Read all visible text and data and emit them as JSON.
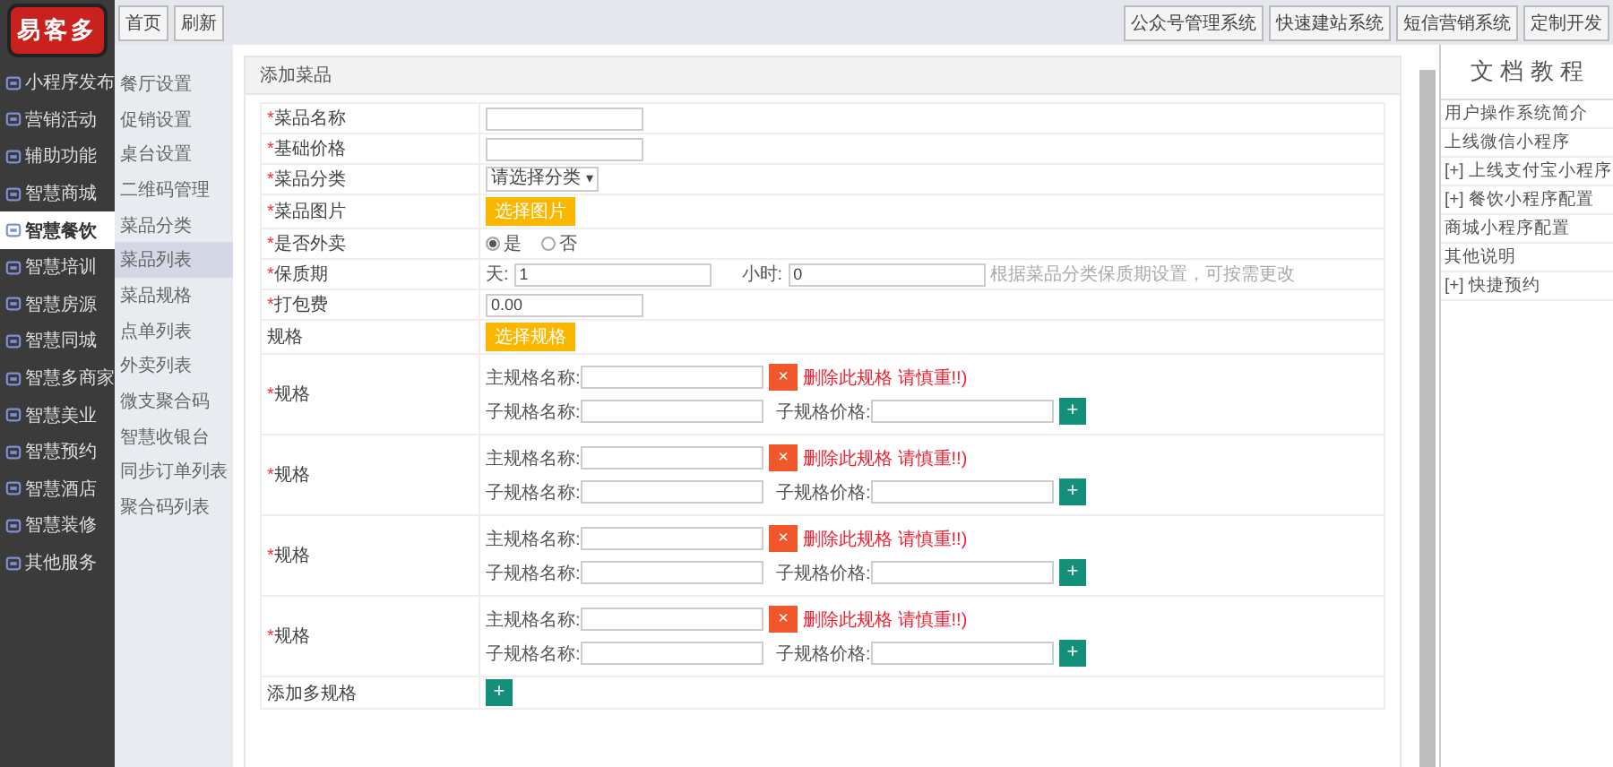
{
  "logo": "易客多",
  "top_buttons": [
    "首页",
    "刷新"
  ],
  "system_links": [
    "公众号管理系统",
    "快速建站系统",
    "短信营销系统",
    "定制开发"
  ],
  "sidebar": {
    "items": [
      {
        "label": "小程序发布",
        "selected": false
      },
      {
        "label": "营销活动",
        "selected": false
      },
      {
        "label": "辅助功能",
        "selected": false
      },
      {
        "label": "智慧商城",
        "selected": false
      },
      {
        "label": "智慧餐饮",
        "selected": true
      },
      {
        "label": "智慧培训",
        "selected": false
      },
      {
        "label": "智慧房源",
        "selected": false
      },
      {
        "label": "智慧同城",
        "selected": false
      },
      {
        "label": "智慧多商家",
        "selected": false
      },
      {
        "label": "智慧美业",
        "selected": false
      },
      {
        "label": "智慧预约",
        "selected": false
      },
      {
        "label": "智慧酒店",
        "selected": false
      },
      {
        "label": "智慧装修",
        "selected": false
      },
      {
        "label": "其他服务",
        "selected": false
      }
    ]
  },
  "submenu": {
    "items": [
      {
        "label": "餐厅设置",
        "selected": false
      },
      {
        "label": "促销设置",
        "selected": false
      },
      {
        "label": "桌台设置",
        "selected": false
      },
      {
        "label": "二维码管理",
        "selected": false
      },
      {
        "label": "菜品分类",
        "selected": false
      },
      {
        "label": "菜品列表",
        "selected": true
      },
      {
        "label": "菜品规格",
        "selected": false
      },
      {
        "label": "点单列表",
        "selected": false
      },
      {
        "label": "外卖列表",
        "selected": false
      },
      {
        "label": "微支聚合码",
        "selected": false
      },
      {
        "label": "智慧收银台",
        "selected": false
      },
      {
        "label": "同步订单列表",
        "selected": false
      },
      {
        "label": "聚合码列表",
        "selected": false
      }
    ]
  },
  "panel": {
    "title": "添加菜品",
    "required_mark": "*",
    "fields": [
      {
        "kind": "text",
        "label": "菜品名称",
        "required": true
      },
      {
        "kind": "text",
        "label": "基础价格",
        "required": true
      },
      {
        "kind": "select",
        "label": "菜品分类",
        "required": true,
        "value": "请选择分类",
        "caret": "▾"
      },
      {
        "kind": "upload",
        "label": "菜品图片",
        "required": true,
        "button": "选择图片"
      },
      {
        "kind": "radio",
        "label": "是否外卖",
        "required": true,
        "options": [
          {
            "label": "是",
            "selected": true
          },
          {
            "label": "否",
            "selected": false
          }
        ]
      },
      {
        "kind": "shelf",
        "label": "保质期",
        "required": true,
        "days_label": "天:",
        "days": "1",
        "hours_label": "小时:",
        "hours": "0",
        "hint": "根据菜品分类保质期设置，可按需更改"
      },
      {
        "kind": "text",
        "label": "打包费",
        "required": true,
        "value": "0.00"
      },
      {
        "kind": "upload",
        "label": "规格",
        "required": false,
        "button": "选择规格"
      }
    ],
    "specs": [
      {
        "label": "规格",
        "required": true,
        "main_label": "主规格名称:",
        "sub_label": "子规格名称:",
        "price_label": "子规格价格:",
        "delete": "×",
        "warning": "删除此规格 请慎重!!)",
        "add": "+"
      },
      {
        "label": "规格",
        "required": true,
        "main_label": "主规格名称:",
        "sub_label": "子规格名称:",
        "price_label": "子规格价格:",
        "delete": "×",
        "warning": "删除此规格 请慎重!!)",
        "add": "+"
      },
      {
        "label": "规格",
        "required": true,
        "main_label": "主规格名称:",
        "sub_label": "子规格名称:",
        "price_label": "子规格价格:",
        "delete": "×",
        "warning": "删除此规格 请慎重!!)",
        "add": "+"
      },
      {
        "label": "规格",
        "required": true,
        "main_label": "主规格名称:",
        "sub_label": "子规格名称:",
        "price_label": "子规格价格:",
        "delete": "×",
        "warning": "删除此规格 请慎重!!)",
        "add": "+"
      }
    ],
    "add_row": {
      "label": "添加多规格",
      "button": "+"
    }
  },
  "docs": {
    "title": "文 档 教 程",
    "items": [
      "用户操作系统简介",
      "上线微信小程序",
      "[+] 上线支付宝小程序",
      "[+] 餐饮小程序配置",
      "商城小程序配置",
      "其他说明",
      "[+] 快捷预约"
    ]
  }
}
